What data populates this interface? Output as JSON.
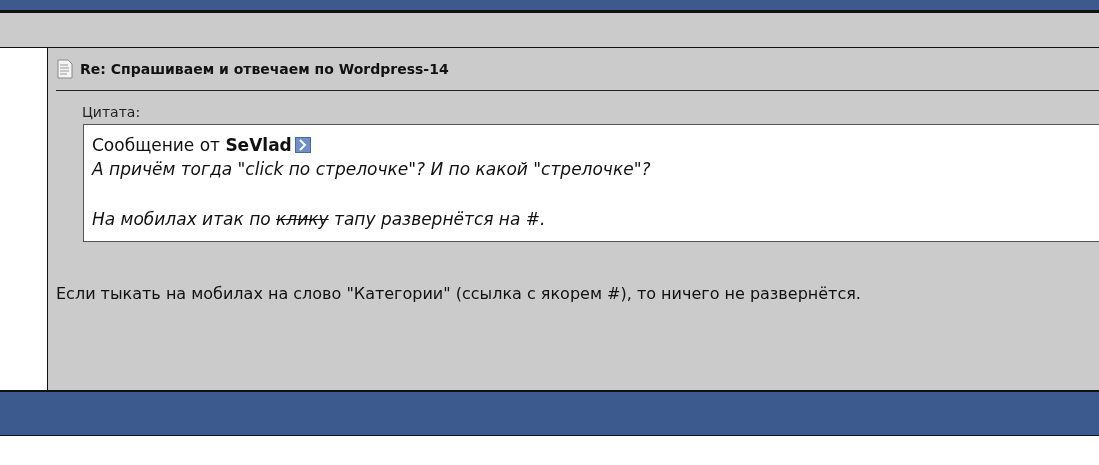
{
  "post": {
    "title": "Re: Спрашиваем и отвечаем по Wordpress-14",
    "quote": {
      "label": "Цитата:",
      "attribution": "Сообщение от **SeVlad**",
      "lines": [
        [
          {
            "text": "А причём тогда \"click по стрелочке\"? И по какой \"стрелочке\"?",
            "struck": false
          }
        ],
        [
          {
            "text": "На мобилах итак по ",
            "struck": false
          },
          {
            "text": "клику",
            "struck": true
          },
          {
            "text": " тапу развернётся на #.",
            "struck": false
          }
        ]
      ]
    },
    "body": "Если тыкать на мобилах на слово \"Категории\" (ссылка с якорем #), то ничего не развернётся."
  }
}
